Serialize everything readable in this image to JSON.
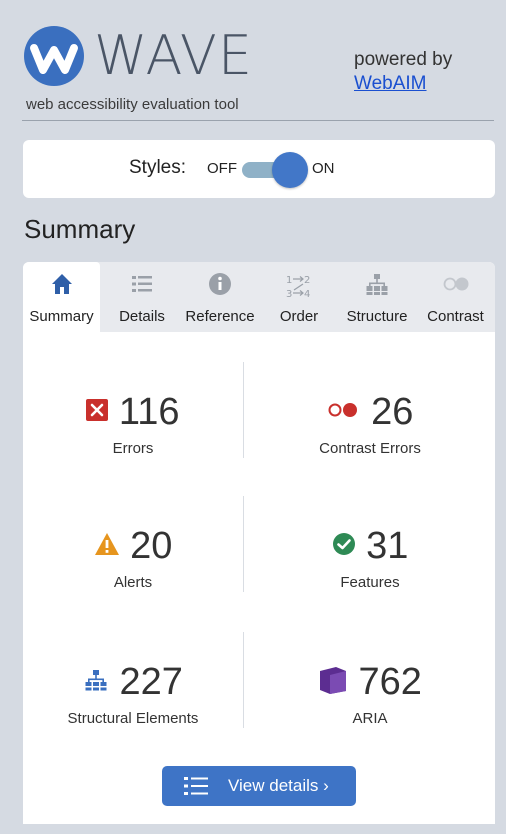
{
  "header": {
    "logo_text": "WAVE",
    "tagline": "web accessibility evaluation tool",
    "powered_by": "powered by",
    "powered_link": "WebAIM"
  },
  "styles_toggle": {
    "label": "Styles:",
    "off": "OFF",
    "on": "ON",
    "state": "ON"
  },
  "summary_heading": "Summary",
  "tabs": [
    {
      "label": "Summary",
      "icon": "home-icon",
      "active": true
    },
    {
      "label": "Details",
      "icon": "list-icon",
      "active": false
    },
    {
      "label": "Reference",
      "icon": "info-icon",
      "active": false
    },
    {
      "label": "Order",
      "icon": "order-icon",
      "active": false
    },
    {
      "label": "Structure",
      "icon": "structure-icon",
      "active": false
    },
    {
      "label": "Contrast",
      "icon": "contrast-icon",
      "active": false
    }
  ],
  "stats": [
    {
      "count": "116",
      "label": "Errors",
      "icon": "error-icon",
      "color": "#c9302c"
    },
    {
      "count": "26",
      "label": "Contrast Errors",
      "icon": "contrast-error-icon",
      "color": "#c9302c"
    },
    {
      "count": "20",
      "label": "Alerts",
      "icon": "alert-icon",
      "color": "#e6951e"
    },
    {
      "count": "31",
      "label": "Features",
      "icon": "feature-icon",
      "color": "#2e8a55"
    },
    {
      "count": "227",
      "label": "Structural Elements",
      "icon": "structure-icon",
      "color": "#3a6fbf"
    },
    {
      "count": "762",
      "label": "ARIA",
      "icon": "aria-icon",
      "color": "#5c2d91"
    }
  ],
  "view_details": {
    "label": "View details ›",
    "icon": "list-icon"
  },
  "colors": {
    "accent": "#3e74c6",
    "background": "#d5dae2",
    "panel": "#ffffff"
  }
}
